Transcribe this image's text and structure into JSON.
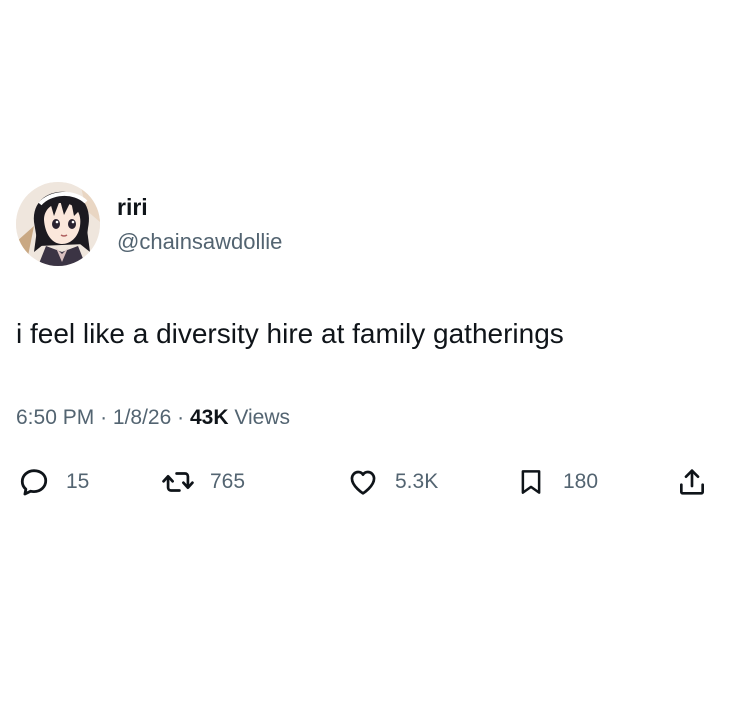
{
  "user": {
    "display_name": "riri",
    "handle": "@chainsawdollie",
    "avatar_icon": "anime-character-avatar"
  },
  "tweet": {
    "text": "i feel like a diversity hire at family gatherings",
    "time": "6:50 PM",
    "separator": "·",
    "date": "1/8/26",
    "views_count": "43K",
    "views_label": "Views"
  },
  "actions": {
    "reply": {
      "icon": "reply-icon",
      "count": "15"
    },
    "retweet": {
      "icon": "retweet-icon",
      "count": "765"
    },
    "like": {
      "icon": "heart-icon",
      "count": "5.3K"
    },
    "bookmark": {
      "icon": "bookmark-icon",
      "count": "180"
    },
    "share": {
      "icon": "share-icon"
    }
  },
  "colors": {
    "text_primary": "#0f1419",
    "text_secondary": "#536471",
    "background": "#ffffff"
  }
}
